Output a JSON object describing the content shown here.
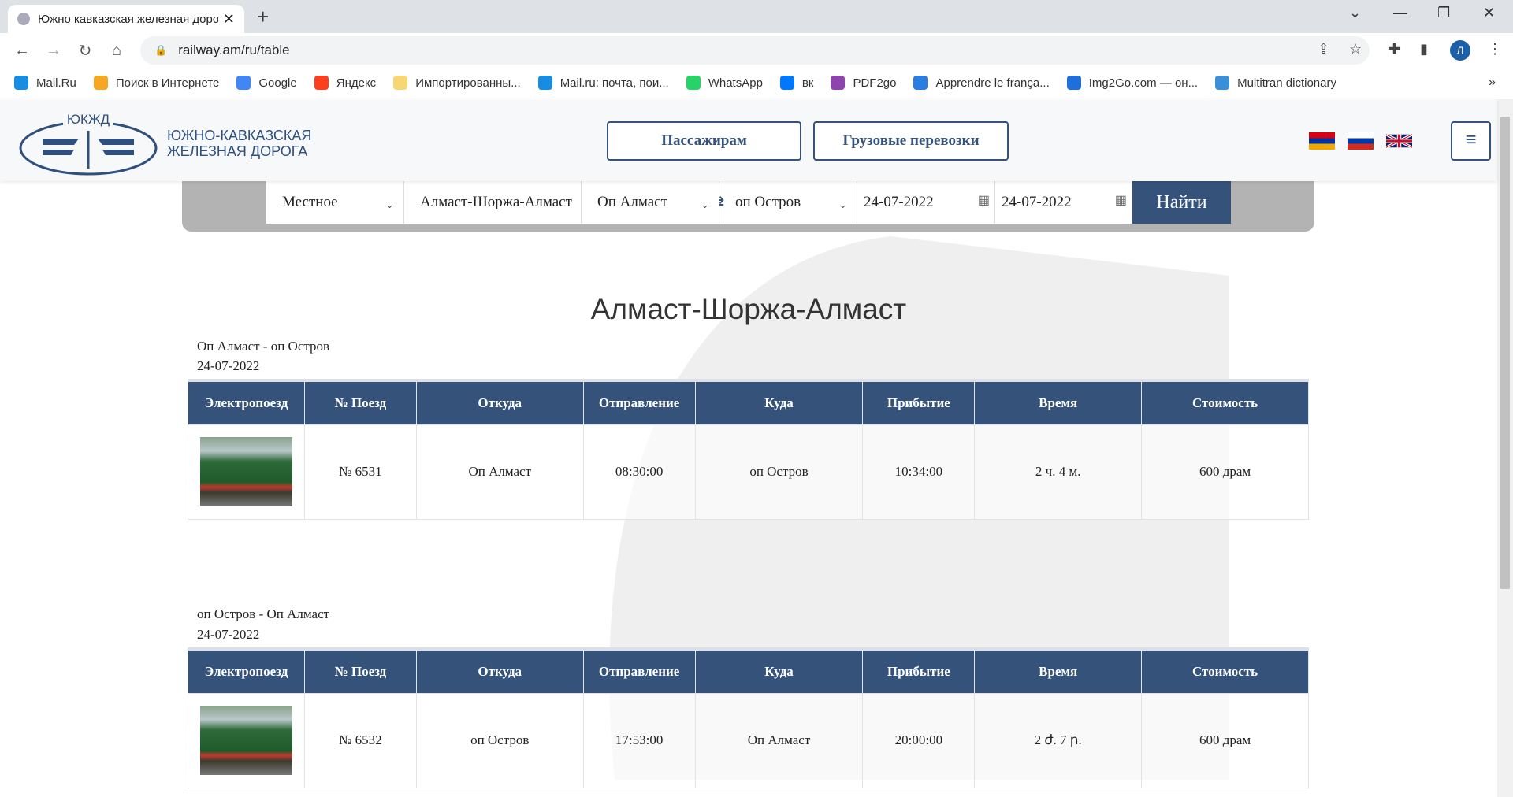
{
  "browser": {
    "tab_title": "Южно кавказская железная дорога",
    "url": "railway.am/ru/table",
    "profile_initial": "Л",
    "bookmarks": [
      {
        "label": "Mail.Ru",
        "color": "#168de2"
      },
      {
        "label": "Поиск в Интернете",
        "color": "#f5a623"
      },
      {
        "label": "Google",
        "color": "#4285f4"
      },
      {
        "label": "Яндекс",
        "color": "#fc3f1d"
      },
      {
        "label": "Импортированны...",
        "color": "#f7d774"
      },
      {
        "label": "Mail.ru: почта, пои...",
        "color": "#168de2"
      },
      {
        "label": "WhatsApp",
        "color": "#25d366"
      },
      {
        "label": "вк",
        "color": "#0077ff"
      },
      {
        "label": "PDF2go",
        "color": "#8e44ad"
      },
      {
        "label": "Apprendre le frança...",
        "color": "#2a7de1"
      },
      {
        "label": "Img2Go.com — он...",
        "color": "#1e6fd9"
      },
      {
        "label": "Multitran dictionary",
        "color": "#3b8fd6"
      }
    ],
    "more": "»"
  },
  "site": {
    "logo_abbr": "ЮКЖД",
    "logo_line1": "ЮЖНО-КАВКАЗСКАЯ",
    "logo_line2": "ЖЕЛЕЗНАЯ ДОРОГА",
    "nav": [
      "Пассажирам",
      "Грузовые перевозки"
    ],
    "menu_icon": "≡"
  },
  "search": {
    "type": "Местное",
    "route": "Алмаст-Шоржа-Алмаст",
    "from": "Оп Алмаст",
    "to": "оп Остров",
    "date_from": "24-07-2022",
    "date_to": "24-07-2022",
    "button": "Найти"
  },
  "page_title": "Алмаст-Шоржа-Алмаст",
  "columns": [
    "Электропоезд",
    "№ Поезд",
    "Откуда",
    "Отправление",
    "Куда",
    "Прибытие",
    "Время",
    "Стоимость"
  ],
  "trips": [
    {
      "route": "Оп Алмаст - оп Остров",
      "date": "24-07-2022",
      "row": {
        "number": "№ 6531",
        "from": "Оп Алмаст",
        "depart": "08:30:00",
        "to": "оп Остров",
        "arrive": "10:34:00",
        "duration": "2 ч. 4 м.",
        "price": "600 драм"
      }
    },
    {
      "route": "оп Остров - Оп Алмаст",
      "date": "24-07-2022",
      "row": {
        "number": "№ 6532",
        "from": "оп Остров",
        "depart": "17:53:00",
        "to": "Оп Алмаст",
        "arrive": "20:00:00",
        "duration": "2 ժ. 7 ր.",
        "price": "600 драм"
      }
    }
  ]
}
